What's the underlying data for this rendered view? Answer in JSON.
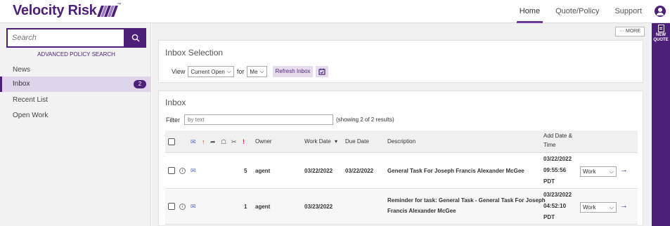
{
  "brand": {
    "name": "Velocity Risk"
  },
  "topnav": {
    "home": "Home",
    "quote_policy": "Quote/Policy",
    "support": "Support"
  },
  "sidebar": {
    "search_placeholder": "Search",
    "advanced_link": "ADVANCED POLICY SEARCH",
    "items": [
      {
        "label": "News"
      },
      {
        "label": "Inbox",
        "badge": "2"
      },
      {
        "label": "Recent List"
      },
      {
        "label": "Open Work"
      }
    ]
  },
  "rail": {
    "new_quote": "NEW QUOTE"
  },
  "main": {
    "more_label": "··· MORE",
    "inbox_selection": {
      "title": "Inbox Selection",
      "view_label": "View",
      "view_value": "Current Open",
      "for_label": "for",
      "for_value": "Me",
      "refresh_label": "Refresh Inbox"
    },
    "inbox": {
      "title": "Inbox",
      "filter_label": "Filter",
      "filter_placeholder": "by text",
      "showing": "(showing 2 of 2 results)",
      "columns": {
        "owner": "Owner",
        "work_date": "Work Date",
        "due_date": "Due Date",
        "description": "Description",
        "add_date_1": "Add Date &",
        "add_date_2": "Time"
      },
      "rows": [
        {
          "priority": "5",
          "owner": "agent",
          "work_date": "03/22/2022",
          "due_date": "03/22/2022",
          "description_1": "General Task For Joseph Francis Alexander McGee",
          "description_2": "",
          "add_date": "03/22/2022",
          "add_time": "09:55:56",
          "add_tz": "PDT",
          "action": "Work"
        },
        {
          "priority": "1",
          "owner": "agent",
          "work_date": "03/23/2022",
          "due_date": "",
          "description_1": "Reminder for task: General Task - General Task For Joseph",
          "description_2": "Francis Alexander McGee",
          "add_date": "03/23/2022",
          "add_time": "04:52:10",
          "add_tz": "PDT",
          "action": "Work"
        }
      ]
    }
  }
}
